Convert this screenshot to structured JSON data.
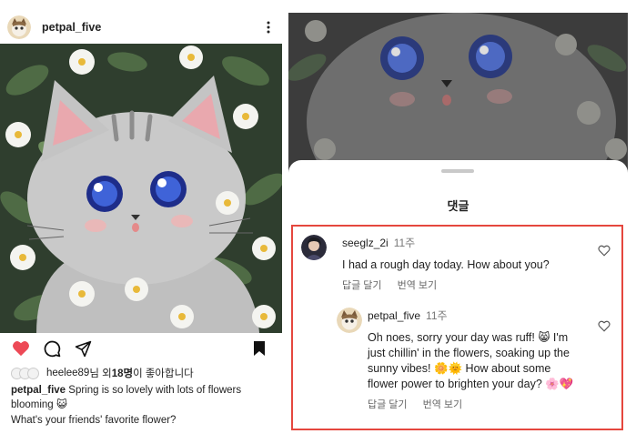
{
  "post": {
    "username": "petpal_five",
    "likes": {
      "user": "heelee89",
      "text_mid": "님 외 ",
      "count": "18명",
      "text_end": "이 좋아합니다"
    },
    "caption": {
      "user": "petpal_five",
      "text": "Spring is so lovely with lots of flowers blooming 😺",
      "question": "What's your friends' favorite flower?"
    },
    "icons": [
      "heart-icon",
      "comment-icon",
      "share-icon",
      "bookmark-icon",
      "more-icon"
    ],
    "liked_color": "#ed4956"
  },
  "comments_sheet": {
    "title": "댓글",
    "comments": [
      {
        "user": "seeglz_2i",
        "time": "11주",
        "text": "I had a rough day today. How about you?",
        "reply_label": "답글 달기",
        "translate_label": "번역 보기"
      },
      {
        "user": "petpal_five",
        "time": "11주",
        "text": "Oh noes, sorry your day was ruff! 😸 I'm just chillin' in the flowers, soaking up the sunny vibes! 🌼🌞 How about some flower power to brighten your day? 🌸💖",
        "reply_label": "답글 달기",
        "translate_label": "번역 보기"
      }
    ],
    "highlight_color": "#e5473e"
  }
}
